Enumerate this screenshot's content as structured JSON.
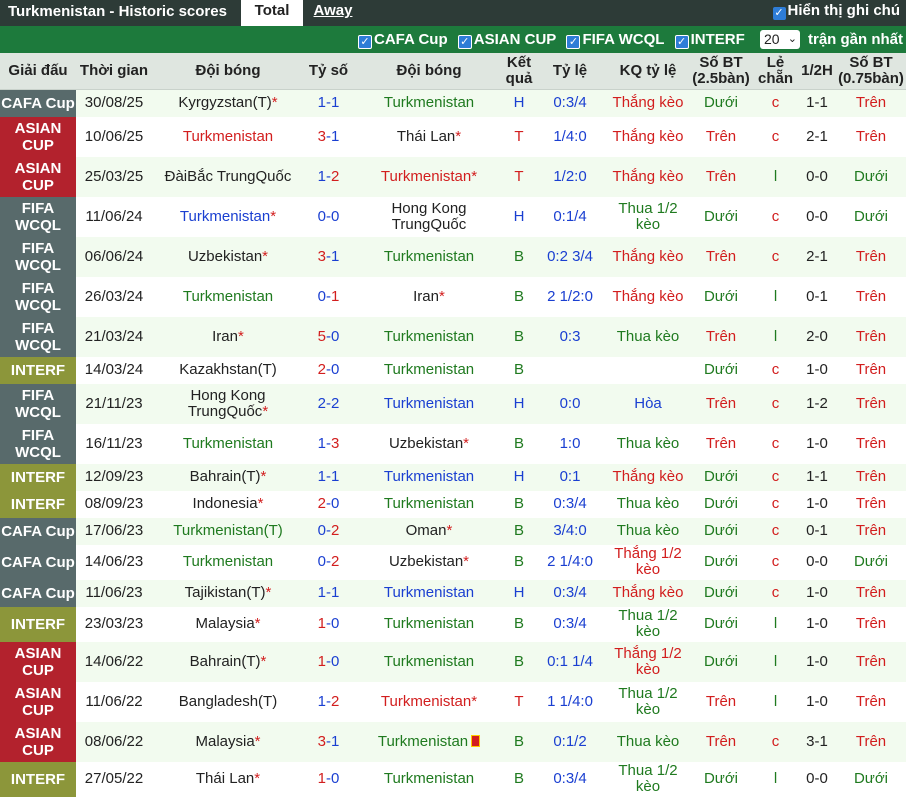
{
  "header": {
    "title": "Turkmenistan - Historic scores",
    "tab_total": "Total",
    "tab_away": "Away",
    "notes_label": "Hiển thị ghi chú"
  },
  "filters": {
    "items": [
      "CAFA Cup",
      "ASIAN CUP",
      "FIFA WCQL",
      "INTERF"
    ],
    "count_value": "20",
    "recent_label": "trận gần nhất"
  },
  "columns": [
    "Giải đấu",
    "Thời gian",
    "Đội bóng",
    "Tỷ số",
    "Đội bóng",
    "Kết quả",
    "Tỷ lệ",
    "KQ tỷ lệ",
    "Số BT (2.5bàn)",
    "Lẻ chẵn",
    "1/2H",
    "Số BT (0.75bàn)"
  ],
  "rows": [
    {
      "league": "CAFA Cup",
      "lt": "cafa",
      "date": "30/08/25",
      "home": "Kyrgyzstan(T)",
      "hs": "*",
      "hc": "black",
      "score_a": "1",
      "score_b": "1",
      "sh": "",
      "away": "Turkmenistan",
      "as": "",
      "ac": "home",
      "res": "H",
      "odds": "0:3/4",
      "kq": "Thắng kèo",
      "kqc": "win",
      "ou": "Dưới",
      "ouc": "under",
      "le": "c",
      "ht": "1-1",
      "ou2": "Trên",
      "ou2c": "over"
    },
    {
      "league": "ASIAN CUP",
      "lt": "asian",
      "date": "10/06/25",
      "home": "Turkmenistan",
      "hs": "",
      "hc": "red",
      "score_a": "3",
      "score_b": "1",
      "sh": "a",
      "away": "Thái Lan",
      "as": "*",
      "ac": "black",
      "res": "T",
      "odds": "1/4:0",
      "kq": "Thắng kèo",
      "kqc": "win",
      "ou": "Trên",
      "ouc": "over",
      "le": "c",
      "ht": "2-1",
      "ou2": "Trên",
      "ou2c": "over"
    },
    {
      "league": "ASIAN CUP",
      "lt": "asian",
      "date": "25/03/25",
      "home": "ĐàiBắc TrungQuốc",
      "hs": "",
      "hc": "black",
      "score_a": "1",
      "score_b": "2",
      "sh": "b",
      "away": "Turkmenistan",
      "as": "*",
      "ac": "red",
      "res": "T",
      "odds": "1/2:0",
      "kq": "Thắng kèo",
      "kqc": "win",
      "ou": "Trên",
      "ouc": "over",
      "le": "l",
      "ht": "0-0",
      "ou2": "Dưới",
      "ou2c": "under"
    },
    {
      "league": "FIFA WCQL",
      "lt": "fifa",
      "date": "11/06/24",
      "home": "Turkmenistan",
      "hs": "*",
      "hc": "blue",
      "score_a": "0",
      "score_b": "0",
      "sh": "",
      "away": "Hong Kong TrungQuốc",
      "as": "",
      "ac": "black",
      "res": "H",
      "odds": "0:1/4",
      "kq": "Thua 1/2 kèo",
      "kqc": "lose",
      "ou": "Dưới",
      "ouc": "under",
      "le": "c",
      "ht": "0-0",
      "ou2": "Dưới",
      "ou2c": "under"
    },
    {
      "league": "FIFA WCQL",
      "lt": "fifa",
      "date": "06/06/24",
      "home": "Uzbekistan",
      "hs": "*",
      "hc": "black",
      "score_a": "3",
      "score_b": "1",
      "sh": "a",
      "away": "Turkmenistan",
      "as": "",
      "ac": "home",
      "res": "B",
      "odds": "0:2 3/4",
      "kq": "Thắng kèo",
      "kqc": "win",
      "ou": "Trên",
      "ouc": "over",
      "le": "c",
      "ht": "2-1",
      "ou2": "Trên",
      "ou2c": "over"
    },
    {
      "league": "FIFA WCQL",
      "lt": "fifa",
      "date": "26/03/24",
      "home": "Turkmenistan",
      "hs": "",
      "hc": "home",
      "score_a": "0",
      "score_b": "1",
      "sh": "b",
      "away": "Iran",
      "as": "*",
      "ac": "black",
      "res": "B",
      "odds": "2 1/2:0",
      "kq": "Thắng kèo",
      "kqc": "win",
      "ou": "Dưới",
      "ouc": "under",
      "le": "l",
      "ht": "0-1",
      "ou2": "Trên",
      "ou2c": "over"
    },
    {
      "league": "FIFA WCQL",
      "lt": "fifa",
      "date": "21/03/24",
      "home": "Iran",
      "hs": "*",
      "hc": "black",
      "score_a": "5",
      "score_b": "0",
      "sh": "a",
      "away": "Turkmenistan",
      "as": "",
      "ac": "home",
      "res": "B",
      "odds": "0:3",
      "kq": "Thua kèo",
      "kqc": "lose",
      "ou": "Trên",
      "ouc": "over",
      "le": "l",
      "ht": "2-0",
      "ou2": "Trên",
      "ou2c": "over"
    },
    {
      "league": "INTERF",
      "lt": "interf",
      "date": "14/03/24",
      "home": "Kazakhstan(T)",
      "hs": "",
      "hc": "black",
      "score_a": "2",
      "score_b": "0",
      "sh": "a",
      "away": "Turkmenistan",
      "as": "",
      "ac": "home",
      "res": "B",
      "odds": "",
      "kq": "",
      "kqc": "lose",
      "ou": "Dưới",
      "ouc": "under",
      "le": "c",
      "ht": "1-0",
      "ou2": "Trên",
      "ou2c": "over"
    },
    {
      "league": "FIFA WCQL",
      "lt": "fifa",
      "date": "21/11/23",
      "home": "Hong Kong TrungQuốc",
      "hs": "*",
      "hc": "black",
      "score_a": "2",
      "score_b": "2",
      "sh": "",
      "away": "Turkmenistan",
      "as": "",
      "ac": "blue",
      "res": "H",
      "odds": "0:0",
      "kq": "Hòa",
      "kqc": "draw",
      "ou": "Trên",
      "ouc": "over",
      "le": "c",
      "ht": "1-2",
      "ou2": "Trên",
      "ou2c": "over"
    },
    {
      "league": "FIFA WCQL",
      "lt": "fifa",
      "date": "16/11/23",
      "home": "Turkmenistan",
      "hs": "",
      "hc": "home",
      "score_a": "1",
      "score_b": "3",
      "sh": "b",
      "away": "Uzbekistan",
      "as": "*",
      "ac": "black",
      "res": "B",
      "odds": "1:0",
      "kq": "Thua kèo",
      "kqc": "lose",
      "ou": "Trên",
      "ouc": "over",
      "le": "c",
      "ht": "1-0",
      "ou2": "Trên",
      "ou2c": "over"
    },
    {
      "league": "INTERF",
      "lt": "interf",
      "date": "12/09/23",
      "home": "Bahrain(T)",
      "hs": "*",
      "hc": "black",
      "score_a": "1",
      "score_b": "1",
      "sh": "",
      "away": "Turkmenistan",
      "as": "",
      "ac": "blue",
      "res": "H",
      "odds": "0:1",
      "kq": "Thắng kèo",
      "kqc": "win",
      "ou": "Dưới",
      "ouc": "under",
      "le": "c",
      "ht": "1-1",
      "ou2": "Trên",
      "ou2c": "over"
    },
    {
      "league": "INTERF",
      "lt": "interf",
      "date": "08/09/23",
      "home": "Indonesia",
      "hs": "*",
      "hc": "black",
      "score_a": "2",
      "score_b": "0",
      "sh": "a",
      "away": "Turkmenistan",
      "as": "",
      "ac": "home",
      "res": "B",
      "odds": "0:3/4",
      "kq": "Thua kèo",
      "kqc": "lose",
      "ou": "Dưới",
      "ouc": "under",
      "le": "c",
      "ht": "1-0",
      "ou2": "Trên",
      "ou2c": "over"
    },
    {
      "league": "CAFA Cup",
      "lt": "cafa",
      "date": "17/06/23",
      "home": "Turkmenistan(T)",
      "hs": "",
      "hc": "home",
      "score_a": "0",
      "score_b": "2",
      "sh": "b",
      "away": "Oman",
      "as": "*",
      "ac": "black",
      "res": "B",
      "odds": "3/4:0",
      "kq": "Thua kèo",
      "kqc": "lose",
      "ou": "Dưới",
      "ouc": "under",
      "le": "c",
      "ht": "0-1",
      "ou2": "Trên",
      "ou2c": "over"
    },
    {
      "league": "CAFA Cup",
      "lt": "cafa",
      "date": "14/06/23",
      "home": "Turkmenistan",
      "hs": "",
      "hc": "home",
      "score_a": "0",
      "score_b": "2",
      "sh": "b",
      "away": "Uzbekistan",
      "as": "*",
      "ac": "black",
      "res": "B",
      "odds": "2 1/4:0",
      "kq": "Thắng 1/2 kèo",
      "kqc": "win",
      "ou": "Dưới",
      "ouc": "under",
      "le": "c",
      "ht": "0-0",
      "ou2": "Dưới",
      "ou2c": "under"
    },
    {
      "league": "CAFA Cup",
      "lt": "cafa",
      "date": "11/06/23",
      "home": "Tajikistan(T)",
      "hs": "*",
      "hc": "black",
      "score_a": "1",
      "score_b": "1",
      "sh": "",
      "away": "Turkmenistan",
      "as": "",
      "ac": "blue",
      "res": "H",
      "odds": "0:3/4",
      "kq": "Thắng kèo",
      "kqc": "win",
      "ou": "Dưới",
      "ouc": "under",
      "le": "c",
      "ht": "1-0",
      "ou2": "Trên",
      "ou2c": "over"
    },
    {
      "league": "INTERF",
      "lt": "interf",
      "date": "23/03/23",
      "home": "Malaysia",
      "hs": "*",
      "hc": "black",
      "score_a": "1",
      "score_b": "0",
      "sh": "a",
      "away": "Turkmenistan",
      "as": "",
      "ac": "home",
      "res": "B",
      "odds": "0:3/4",
      "kq": "Thua 1/2 kèo",
      "kqc": "lose",
      "ou": "Dưới",
      "ouc": "under",
      "le": "l",
      "ht": "1-0",
      "ou2": "Trên",
      "ou2c": "over"
    },
    {
      "league": "ASIAN CUP",
      "lt": "asian",
      "date": "14/06/22",
      "home": "Bahrain(T)",
      "hs": "*",
      "hc": "black",
      "score_a": "1",
      "score_b": "0",
      "sh": "a",
      "away": "Turkmenistan",
      "as": "",
      "ac": "home",
      "res": "B",
      "odds": "0:1 1/4",
      "kq": "Thắng 1/2 kèo",
      "kqc": "win",
      "ou": "Dưới",
      "ouc": "under",
      "le": "l",
      "ht": "1-0",
      "ou2": "Trên",
      "ou2c": "over"
    },
    {
      "league": "ASIAN CUP",
      "lt": "asian",
      "date": "11/06/22",
      "home": "Bangladesh(T)",
      "hs": "",
      "hc": "black",
      "score_a": "1",
      "score_b": "2",
      "sh": "b",
      "away": "Turkmenistan",
      "as": "*",
      "ac": "red",
      "res": "T",
      "odds": "1 1/4:0",
      "kq": "Thua 1/2 kèo",
      "kqc": "lose",
      "ou": "Trên",
      "ouc": "over",
      "le": "l",
      "ht": "1-0",
      "ou2": "Trên",
      "ou2c": "over"
    },
    {
      "league": "ASIAN CUP",
      "lt": "asian",
      "date": "08/06/22",
      "home": "Malaysia",
      "hs": "*",
      "hc": "black",
      "score_a": "3",
      "score_b": "1",
      "sh": "a",
      "away": "Turkmenistan",
      "as": "",
      "ac": "home",
      "flag": true,
      "res": "B",
      "odds": "0:1/2",
      "kq": "Thua kèo",
      "kqc": "lose",
      "ou": "Trên",
      "ouc": "over",
      "le": "c",
      "ht": "3-1",
      "ou2": "Trên",
      "ou2c": "over"
    },
    {
      "league": "INTERF",
      "lt": "interf",
      "date": "27/05/22",
      "home": "Thái Lan",
      "hs": "*",
      "hc": "black",
      "score_a": "1",
      "score_b": "0",
      "sh": "a",
      "away": "Turkmenistan",
      "as": "",
      "ac": "home",
      "res": "B",
      "odds": "0:3/4",
      "kq": "Thua 1/2 kèo",
      "kqc": "lose",
      "ou": "Dưới",
      "ouc": "under",
      "le": "l",
      "ht": "0-0",
      "ou2": "Dưới",
      "ou2c": "under"
    }
  ]
}
